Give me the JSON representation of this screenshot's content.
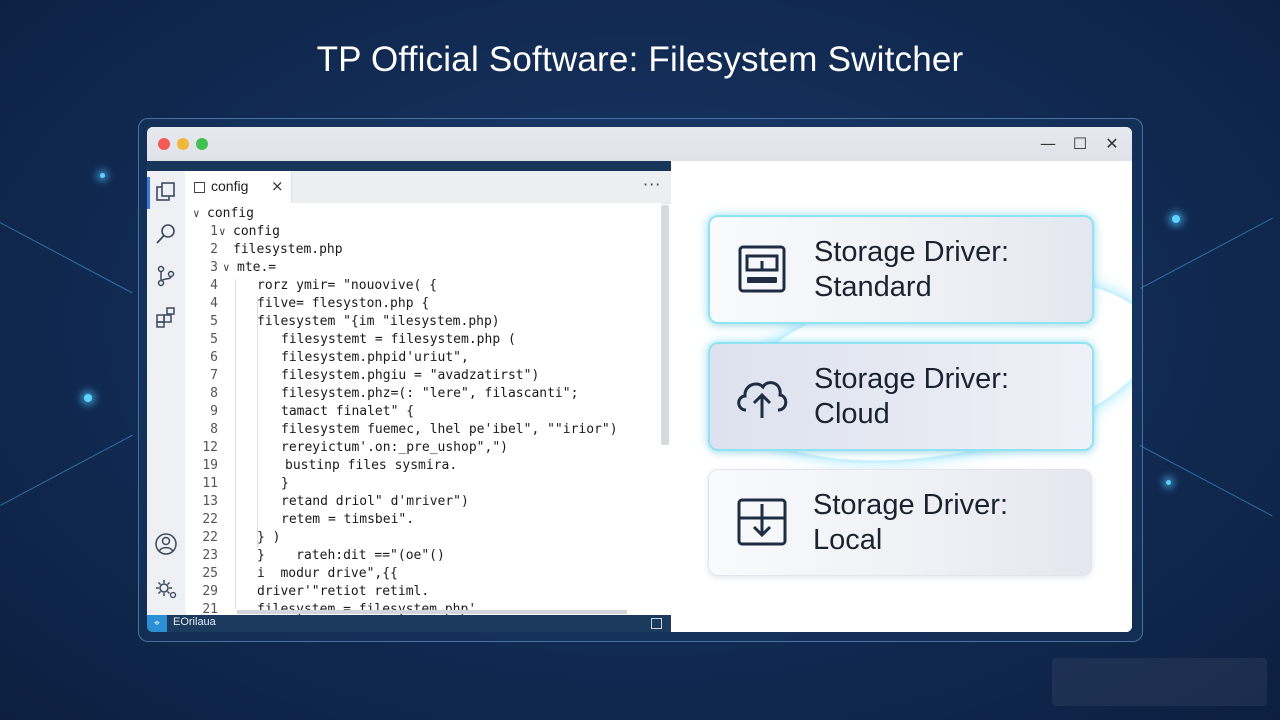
{
  "headline": "TP Official Software: Filesystem Switcher",
  "window_controls": {
    "minimize": "—",
    "maximize": "☐",
    "close": "✕"
  },
  "editor": {
    "tab_label": "config",
    "tab_close": "×",
    "more": "···",
    "tree_root": "config",
    "lines": [
      {
        "num": "1",
        "text": "config"
      },
      {
        "num": "2",
        "text": "filesystem.php"
      },
      {
        "num": "3",
        "text": "mte.="
      },
      {
        "num": "4",
        "text": "rorz ymir= \"nouovive( {"
      },
      {
        "num": "4",
        "text": "filve= flesyston.php {"
      },
      {
        "num": "5",
        "text": "filesystem \"{im \"ilesystem.php)"
      },
      {
        "num": "5",
        "text": "filesystemt = filesystem.php ("
      },
      {
        "num": "6",
        "text": "filesystem.phpid'uriut\","
      },
      {
        "num": "7",
        "text": "filesystem.phgiu = \"avadzatirst\")"
      },
      {
        "num": "8",
        "text": "filesystem.phz=(: \"lere\", filascanti\";"
      },
      {
        "num": "9",
        "text": "tamact finalet\" {"
      },
      {
        "num": "8",
        "text": "filesystem fuemec, lhel pe'ibel\", \"\"irior\")"
      },
      {
        "num": "12",
        "text": "rereyictum'.on:_pre_ushop\",\")"
      },
      {
        "num": "19",
        "text": "bustinp files sysmira."
      },
      {
        "num": "11",
        "text": "}"
      },
      {
        "num": "13",
        "text": "retand driol\" d'mriver\")"
      },
      {
        "num": "22",
        "text": "retem = timsbei\"."
      },
      {
        "num": "22",
        "text": "} )"
      },
      {
        "num": "23",
        "text": "}    rateh:dit ==\"(oe\"()"
      },
      {
        "num": "25",
        "text": "i  modur drive\",{{"
      },
      {
        "num": "29",
        "text": "driver'\"retiot retiml."
      },
      {
        "num": "21",
        "text": "filesystem = filesystem.php'"
      }
    ]
  },
  "status_bar": {
    "text": "EOrilaua",
    "branch_icon": "⌖"
  },
  "storage_options": [
    {
      "label": "Storage Driver:\nStandard",
      "icon": "drive-icon",
      "state": "glow"
    },
    {
      "label": "Storage Driver:\nCloud",
      "icon": "cloud-upload-icon",
      "state": "selected"
    },
    {
      "label": "Storage Driver:\nLocal",
      "icon": "download-box-icon",
      "state": "normal"
    }
  ],
  "colors": {
    "accent": "#3b7ad9",
    "glow": "#8fe3f2",
    "status_bar": "#1c3a5e",
    "background": "#132d57"
  }
}
